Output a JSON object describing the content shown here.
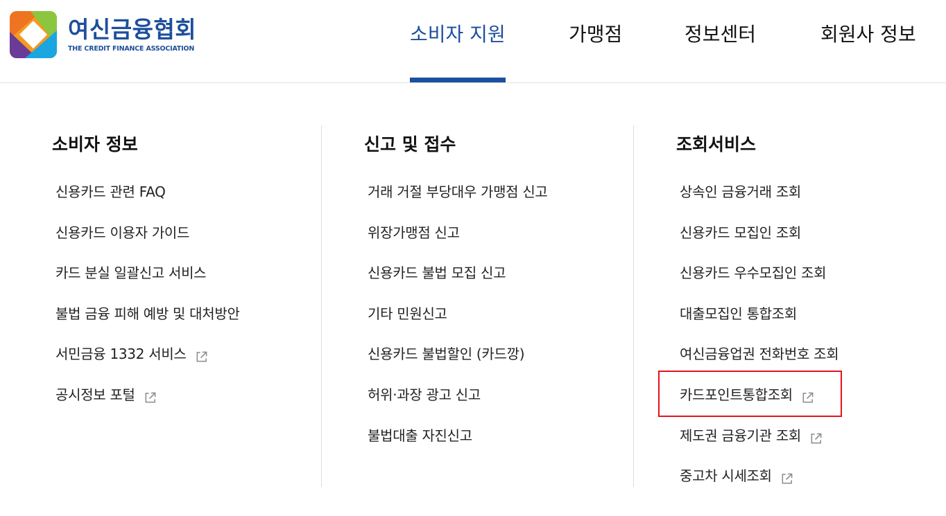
{
  "brand": {
    "name_ko": "여신금융협회",
    "name_en": "THE CREDIT FINANCE ASSOCIATION",
    "colors": {
      "primary": "#1d4f9c",
      "highlight": "#e5121a"
    }
  },
  "gnb": {
    "items": [
      {
        "label": "소비자 지원",
        "active": true
      },
      {
        "label": "가맹점",
        "active": false
      },
      {
        "label": "정보센터",
        "active": false
      },
      {
        "label": "회원사 정보",
        "active": false
      }
    ]
  },
  "columns": [
    {
      "title": "소비자 정보",
      "items": [
        {
          "label": "신용카드 관련 FAQ",
          "external": false
        },
        {
          "label": "신용카드 이용자 가이드",
          "external": false
        },
        {
          "label": "카드 분실 일괄신고 서비스",
          "external": false
        },
        {
          "label": "불법 금융 피해 예방 및 대처방안",
          "external": false
        },
        {
          "label": "서민금융 1332 서비스",
          "external": true
        },
        {
          "label": "공시정보 포털",
          "external": true
        }
      ]
    },
    {
      "title": "신고 및 접수",
      "items": [
        {
          "label": "거래 거절 부당대우 가맹점 신고",
          "external": false
        },
        {
          "label": "위장가맹점 신고",
          "external": false
        },
        {
          "label": "신용카드 불법 모집 신고",
          "external": false
        },
        {
          "label": "기타 민원신고",
          "external": false
        },
        {
          "label": "신용카드 불법할인 (카드깡)",
          "external": false
        },
        {
          "label": "허위·과장 광고 신고",
          "external": false
        },
        {
          "label": "불법대출 자진신고",
          "external": false
        }
      ]
    },
    {
      "title": "조회서비스",
      "items": [
        {
          "label": "상속인 금융거래 조회",
          "external": false
        },
        {
          "label": "신용카드 모집인 조회",
          "external": false
        },
        {
          "label": "신용카드 우수모집인 조회",
          "external": false
        },
        {
          "label": "대출모집인 통합조회",
          "external": false
        },
        {
          "label": "여신금융업권 전화번호 조회",
          "external": false
        },
        {
          "label": "카드포인트통합조회",
          "external": true,
          "highlighted": true
        },
        {
          "label": "제도권 금융기관 조회",
          "external": true
        },
        {
          "label": "중고차 시세조회",
          "external": true
        }
      ]
    }
  ],
  "icons": {
    "external_link": "external-link-icon"
  }
}
